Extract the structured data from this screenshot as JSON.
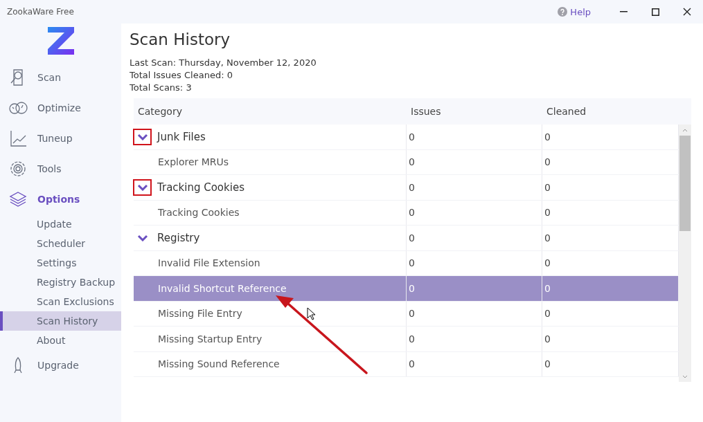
{
  "window": {
    "title": "ZookaWare Free",
    "help": "Help"
  },
  "sidebar": {
    "items": [
      {
        "label": "Scan",
        "kind": "scan",
        "selected": false
      },
      {
        "label": "Optimize",
        "kind": "gauge",
        "selected": false
      },
      {
        "label": "Tuneup",
        "kind": "chart",
        "selected": false
      },
      {
        "label": "Tools",
        "kind": "gear",
        "selected": false
      },
      {
        "label": "Options",
        "kind": "layers",
        "selected": true,
        "children": [
          {
            "label": "Update",
            "selected": false
          },
          {
            "label": "Scheduler",
            "selected": false
          },
          {
            "label": "Settings",
            "selected": false
          },
          {
            "label": "Registry Backup",
            "selected": false
          },
          {
            "label": "Scan Exclusions",
            "selected": false
          },
          {
            "label": "Scan History",
            "selected": true
          },
          {
            "label": "About",
            "selected": false
          }
        ]
      },
      {
        "label": "Upgrade",
        "kind": "rocket",
        "selected": false
      }
    ]
  },
  "page": {
    "title": "Scan History",
    "summary": [
      "Last Scan: Thursday, November 12, 2020",
      "Total Issues Cleaned: 0",
      "Total Scans: 3"
    ]
  },
  "table": {
    "columns": [
      "Category",
      "Issues",
      "Cleaned"
    ],
    "groups": [
      {
        "label": "Junk Files",
        "issues": "0",
        "cleaned": "0",
        "expanded": true,
        "highlighted": true,
        "children": [
          {
            "label": "Explorer MRUs",
            "issues": "0",
            "cleaned": "0",
            "selected": false
          }
        ]
      },
      {
        "label": "Tracking Cookies",
        "issues": "0",
        "cleaned": "0",
        "expanded": true,
        "highlighted": true,
        "children": [
          {
            "label": "Tracking Cookies",
            "issues": "0",
            "cleaned": "0",
            "selected": false
          }
        ]
      },
      {
        "label": "Registry",
        "issues": "0",
        "cleaned": "0",
        "expanded": true,
        "highlighted": false,
        "children": [
          {
            "label": "Invalid File Extension",
            "issues": "0",
            "cleaned": "0",
            "selected": false
          },
          {
            "label": "Invalid Shortcut Reference",
            "issues": "0",
            "cleaned": "0",
            "selected": true
          },
          {
            "label": "Missing File Entry",
            "issues": "0",
            "cleaned": "0",
            "selected": false
          },
          {
            "label": "Missing Startup Entry",
            "issues": "0",
            "cleaned": "0",
            "selected": false
          },
          {
            "label": "Missing Sound Reference",
            "issues": "0",
            "cleaned": "0",
            "selected": false
          }
        ]
      }
    ]
  }
}
